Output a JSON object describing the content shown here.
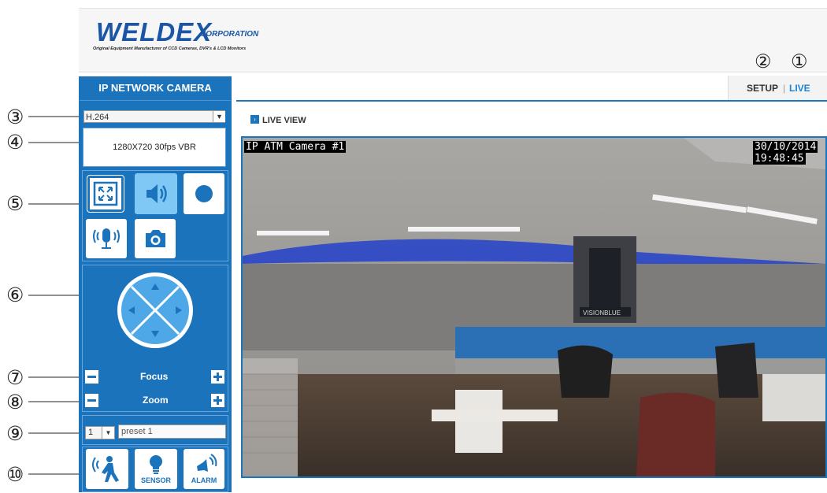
{
  "header": {
    "brand": "WELDEX",
    "brand_suffix": "CORPORATION",
    "tagline": "Original Equipment Manufacturer of CCD Cameras, DVR's & LCD Monitors"
  },
  "nav": {
    "setup": "SETUP",
    "separator": "|",
    "live": "LIVE",
    "callouts": [
      "②",
      "①"
    ]
  },
  "panel": {
    "title": "IP NETWORK CAMERA",
    "codec": "H.264",
    "stream_info": "1280X720 30fps VBR",
    "focus_label": "Focus",
    "zoom_label": "Zoom",
    "preset_number": "1",
    "preset_name": "preset 1",
    "sensor_label": "SENSOR",
    "alarm_label": "ALARM"
  },
  "callouts": [
    "③",
    "④",
    "⑤",
    "⑥",
    "⑦",
    "⑧",
    "⑨",
    "⑩"
  ],
  "main": {
    "heading": "LIVE VIEW"
  },
  "video": {
    "camera_name": "IP ATM Camera #1",
    "date": "30/10/2014",
    "time": "19:48:45",
    "wall_sign": "VISIONBLUE"
  },
  "colors": {
    "accent": "#1a73bb",
    "live_link": "#1c83d3"
  }
}
